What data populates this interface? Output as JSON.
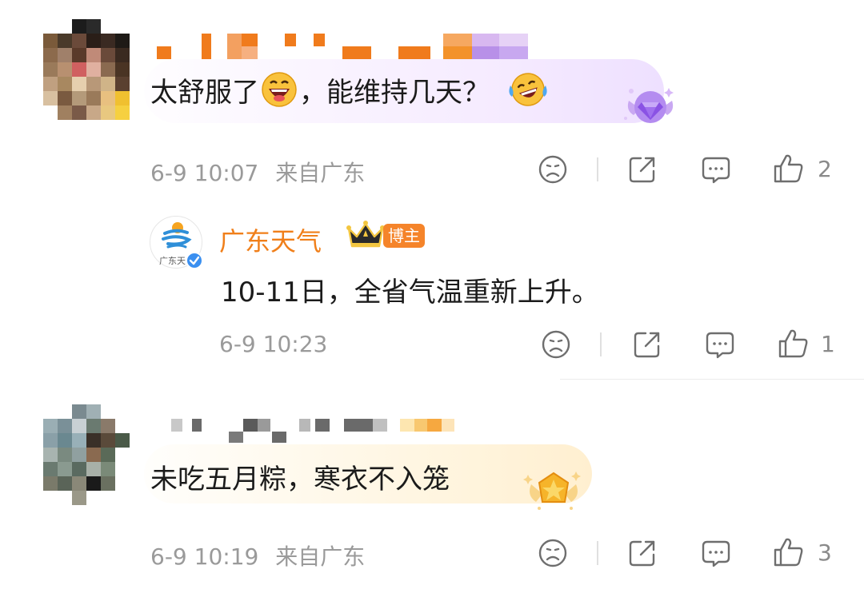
{
  "comments": [
    {
      "text": "太舒服了",
      "text_after": "，能维持几天？",
      "timestamp": "6-9 10:07",
      "location": "来自广东",
      "likes": "2",
      "reply": {
        "author": "广东天气",
        "badge": "博主",
        "logo_text": "广东天",
        "text": "10-11日，全省气温重新上升。",
        "timestamp": "6-9 10:23",
        "likes": "1"
      }
    },
    {
      "text": "未吃五月粽，寒衣不入笼",
      "timestamp": "6-9 10:19",
      "location": "来自广东",
      "likes": "3"
    }
  ],
  "colors": {
    "author": "#f07f1a",
    "badge": "#f5842a",
    "meta": "#9a9a9a",
    "icon": "#7a7a7a"
  },
  "icons": [
    "sad-face-icon",
    "share-icon",
    "comment-icon",
    "like-icon",
    "laughing-emoji-icon",
    "crying-laughing-emoji-icon",
    "purple-gem-badge-icon",
    "gold-star-badge-icon",
    "crown-icon",
    "verified-icon"
  ]
}
